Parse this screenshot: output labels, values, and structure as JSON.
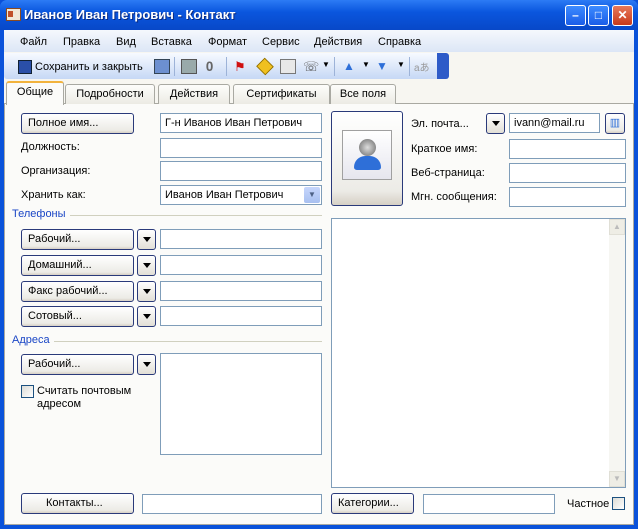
{
  "window": {
    "title": "Иванов Иван Петрович - Контакт"
  },
  "menu": [
    "Файл",
    "Правка",
    "Вид",
    "Вставка",
    "Формат",
    "Сервис",
    "Действия",
    "Справка"
  ],
  "toolbar": {
    "save_close": "Сохранить и закрыть"
  },
  "tabs": [
    "Общие",
    "Подробности",
    "Действия",
    "Сертификаты",
    "Все поля"
  ],
  "general": {
    "full_name_button": "Полное имя...",
    "full_name": "Г-н Иванов Иван Петрович",
    "job_title_label": "Должность:",
    "job_title": "",
    "company_label": "Организация:",
    "company": "",
    "file_as_label": "Хранить как:",
    "file_as": "Иванов Иван Петрович",
    "phones_heading": "Телефоны",
    "phones": [
      {
        "label": "Рабочий...",
        "value": ""
      },
      {
        "label": "Домашний...",
        "value": ""
      },
      {
        "label": "Факс рабочий...",
        "value": ""
      },
      {
        "label": "Сотовый...",
        "value": ""
      }
    ],
    "addresses_heading": "Адреса",
    "address_button": "Рабочий...",
    "address": "",
    "mailing_checkbox": "Считать почтовым адресом",
    "mailing_checked": false,
    "email_label": "Эл. почта...",
    "email": "ivann@mail.ru",
    "display_name_label": "Краткое имя:",
    "display_name": "",
    "web_label": "Веб-страница:",
    "web": "",
    "im_label": "Мгн. сообщения:",
    "im": "",
    "notes": "",
    "contacts_button": "Контакты...",
    "contacts": "",
    "categories_button": "Категории...",
    "categories": "",
    "private_label": "Частное",
    "private_checked": false
  }
}
